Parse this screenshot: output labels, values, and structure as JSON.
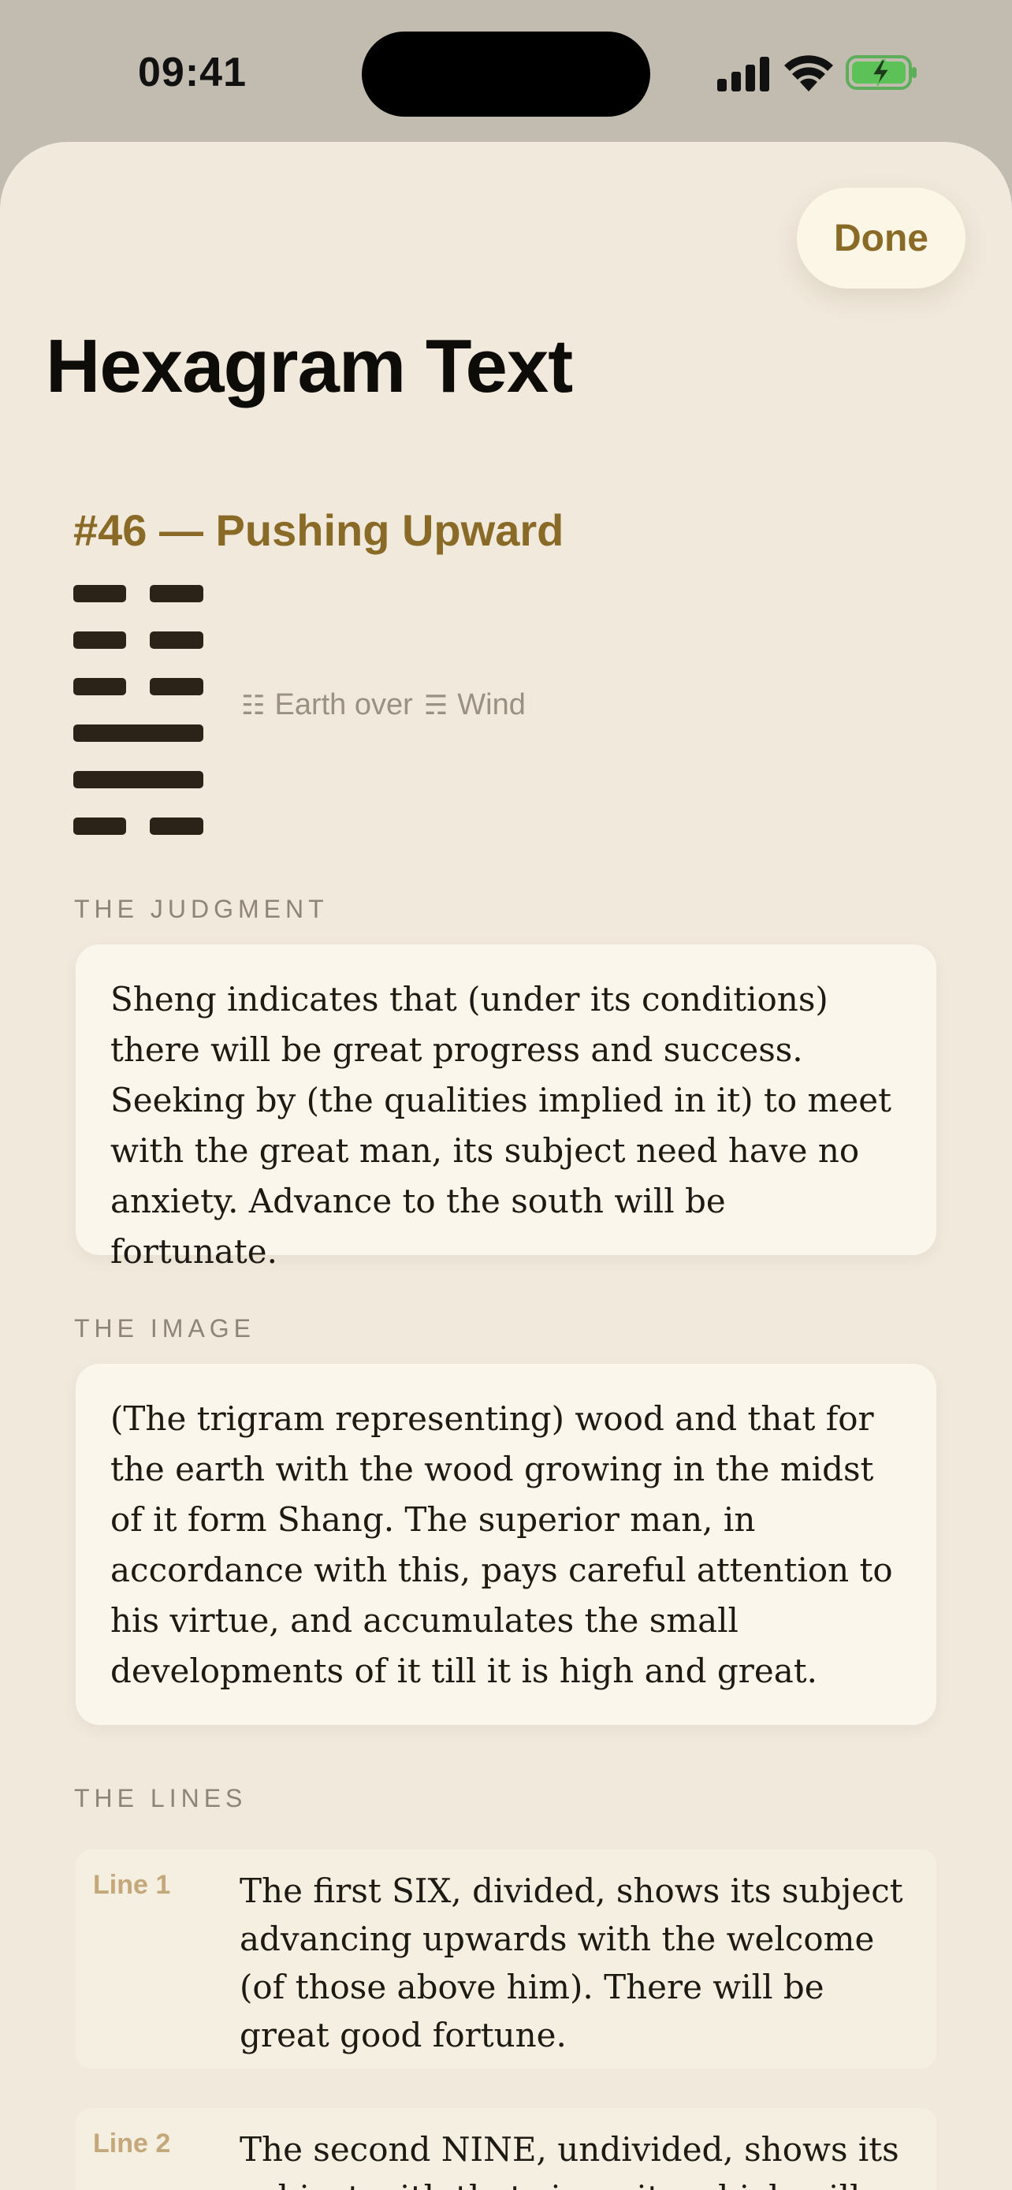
{
  "status_bar": {
    "time": "09:41"
  },
  "sheet": {
    "done_label": "Done",
    "title": "Hexagram Text"
  },
  "hexagram": {
    "heading": "#46 — Pushing Upward",
    "lines_top_to_bottom": [
      "yin",
      "yin",
      "yin",
      "yang",
      "yang",
      "yin"
    ],
    "upper_trigram_symbol": "☷",
    "upper_trigram": "Earth",
    "connector": "over",
    "lower_trigram_symbol": "☴",
    "lower_trigram": "Wind"
  },
  "judgment": {
    "label": "THE JUDGMENT",
    "text": "Sheng indicates that (under its conditions) there will be great progress and success. Seeking by (the qualities implied in it) to meet with the great man, its subject need have no anxiety. Advance to the south will be fortunate."
  },
  "image": {
    "label": "THE IMAGE",
    "text": "(The trigram representing) wood and that for the earth with the wood growing in the midst of it form Shang. The superior man, in accordance with this, pays careful attention to his virtue, and accumulates the small developments of it till it is high and great."
  },
  "lines_section": {
    "label": "THE LINES",
    "items": [
      {
        "label": "Line 1",
        "text": "The first SIX, divided, shows its subject advancing upwards with the welcome (of those above him). There will be great good fortune."
      },
      {
        "label": "Line 2",
        "text": "The second NINE, undivided, shows its subject with that sincerity which will"
      }
    ]
  },
  "colors": {
    "accent": "#8a6a27",
    "sheet_background": "#f1e9dc",
    "card_background": "#faf6ec",
    "status_bar_background": "#c2bbb0"
  }
}
